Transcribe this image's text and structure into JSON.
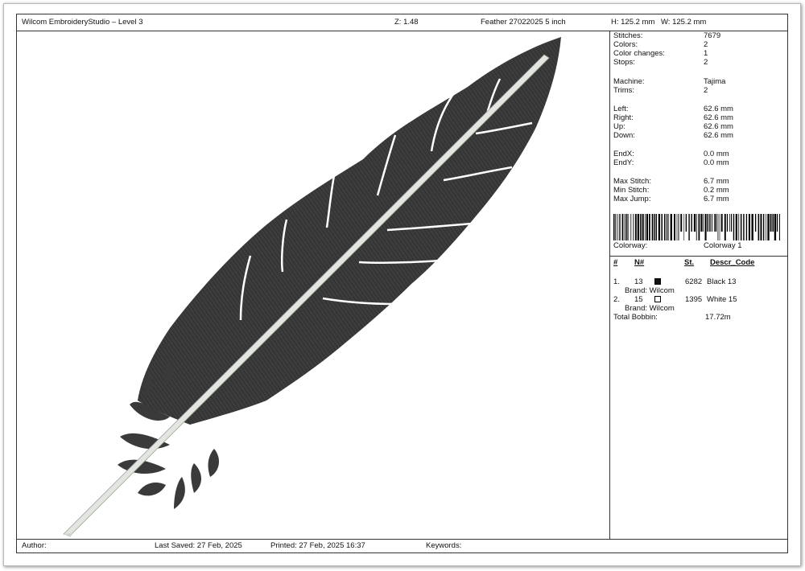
{
  "header": {
    "app_title": "Wilcom EmbroideryStudio – Level 3",
    "zoom": "Z: 1.48",
    "design_name": "Feather 27022025 5 inch",
    "height": "H: 125.2 mm",
    "width": "W: 125.2 mm"
  },
  "stats": {
    "stitches_label": "Stitches:",
    "stitches": "7679",
    "colors_label": "Colors:",
    "colors": "2",
    "color_changes_label": "Color changes:",
    "color_changes": "1",
    "stops_label": "Stops:",
    "stops": "2",
    "machine_label": "Machine:",
    "machine": "Tajima",
    "trims_label": "Trims:",
    "trims": "2",
    "left_label": "Left:",
    "left": "62.6 mm",
    "right_label": "Right:",
    "right": "62.6 mm",
    "up_label": "Up:",
    "up": "62.6 mm",
    "down_label": "Down:",
    "down": "62.6 mm",
    "endx_label": "EndX:",
    "endx": "0.0 mm",
    "endy_label": "EndY:",
    "endy": "0.0 mm",
    "max_stitch_label": "Max Stitch:",
    "max_stitch": "6.7 mm",
    "min_stitch_label": "Min Stitch:",
    "min_stitch": "0.2 mm",
    "max_jump_label": "Max Jump:",
    "max_jump": "6.7 mm"
  },
  "colorway": {
    "label": "Colorway:",
    "value": "Colorway 1"
  },
  "color_table": {
    "headers": {
      "num": "#",
      "n": "N#",
      "st": "St.",
      "descr": "Descr_Code"
    },
    "rows": [
      {
        "index": "1.",
        "n": "13",
        "swatch": "#111111",
        "stitches": "6282",
        "descr": "Black 13",
        "brand": "Brand: Wilcom"
      },
      {
        "index": "2.",
        "n": "15",
        "swatch": "#ffffff",
        "stitches": "1395",
        "descr": "White 15",
        "brand": "Brand: Wilcom"
      }
    ],
    "total_bobbin_label": "Total Bobbin:",
    "total_bobbin": "17.72m"
  },
  "footer": {
    "author": "Author:",
    "last_saved": "Last Saved: 27 Feb, 2025",
    "printed": "Printed: 27 Feb, 2025 16:37",
    "keywords": "Keywords:"
  },
  "colors": {
    "feather_dark": "#3a3a3a",
    "feather_shaft": "#e2e6df"
  }
}
